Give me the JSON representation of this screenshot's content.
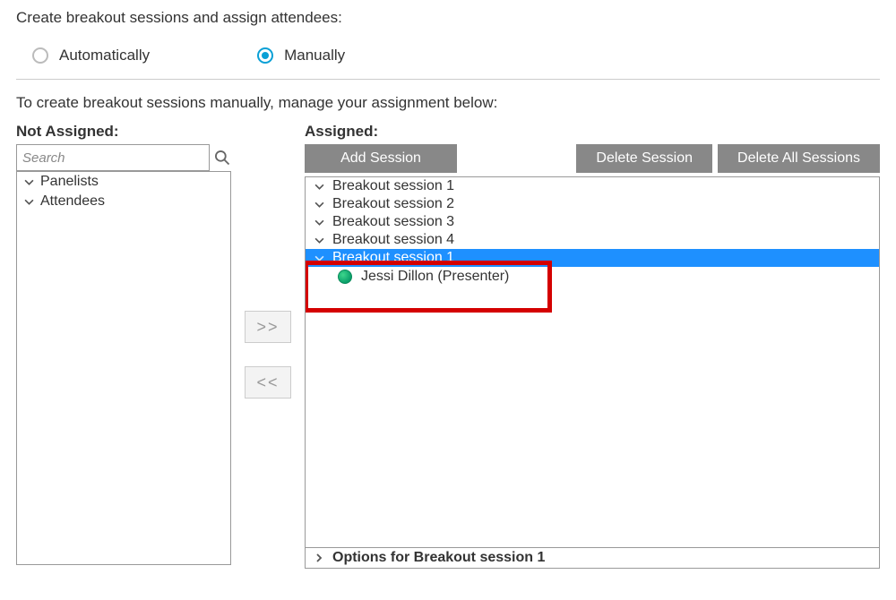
{
  "header": {
    "title": "Create breakout sessions and assign attendees:"
  },
  "mode": {
    "auto_label": "Automatically",
    "manual_label": "Manually",
    "selected": "manual"
  },
  "instruction": "To create breakout sessions manually, manage your assignment below:",
  "not_assigned": {
    "label": "Not Assigned:",
    "search_placeholder": "Search",
    "groups": [
      {
        "label": "Panelists"
      },
      {
        "label": "Attendees"
      }
    ]
  },
  "assigned": {
    "label": "Assigned:",
    "buttons": {
      "add": "Add Session",
      "delete": "Delete Session",
      "delete_all": "Delete All Sessions"
    },
    "sessions": [
      {
        "label": "Breakout session 1",
        "expanded": false,
        "selected": false
      },
      {
        "label": "Breakout session 2",
        "expanded": false,
        "selected": false
      },
      {
        "label": "Breakout session 3",
        "expanded": false,
        "selected": false
      },
      {
        "label": "Breakout session 4",
        "expanded": false,
        "selected": false
      },
      {
        "label": "Breakout session 1",
        "expanded": true,
        "selected": true,
        "attendees": [
          {
            "name": "Jessi Dillon (Presenter)"
          }
        ]
      }
    ],
    "options_label": "Options for Breakout session 1"
  },
  "move": {
    "right": ">>",
    "left": "<<"
  }
}
